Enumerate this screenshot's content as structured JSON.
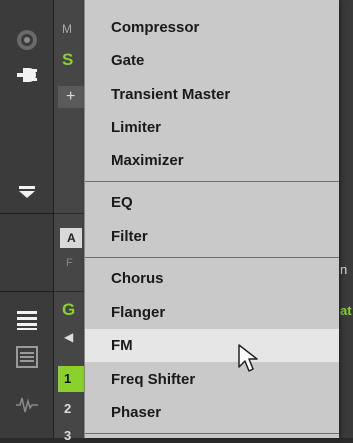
{
  "background": {
    "top_channel_letter": "M",
    "sound_slot_letter": "S",
    "add_symbol": "+",
    "group_slot_letter": "A",
    "group_sub_letter": "F",
    "group_name_letter": "G",
    "pad_rows": [
      "1",
      "2",
      "3"
    ],
    "right_edge_top_text": "n",
    "right_edge_bottom_text": "at"
  },
  "menu": {
    "sections": [
      {
        "items": [
          {
            "label": "Compressor",
            "highlighted": false
          },
          {
            "label": "Gate",
            "highlighted": false
          },
          {
            "label": "Transient Master",
            "highlighted": false
          },
          {
            "label": "Limiter",
            "highlighted": false
          },
          {
            "label": "Maximizer",
            "highlighted": false
          }
        ]
      },
      {
        "items": [
          {
            "label": "EQ",
            "highlighted": false
          },
          {
            "label": "Filter",
            "highlighted": false
          }
        ]
      },
      {
        "items": [
          {
            "label": "Chorus",
            "highlighted": false
          },
          {
            "label": "Flanger",
            "highlighted": false
          },
          {
            "label": "FM",
            "highlighted": true
          },
          {
            "label": "Freq Shifter",
            "highlighted": false
          },
          {
            "label": "Phaser",
            "highlighted": false
          }
        ]
      }
    ]
  },
  "colors": {
    "accent_green": "#8bd12b",
    "menu_background": "#c9c9c9",
    "menu_highlight": "#e6e6e6"
  }
}
